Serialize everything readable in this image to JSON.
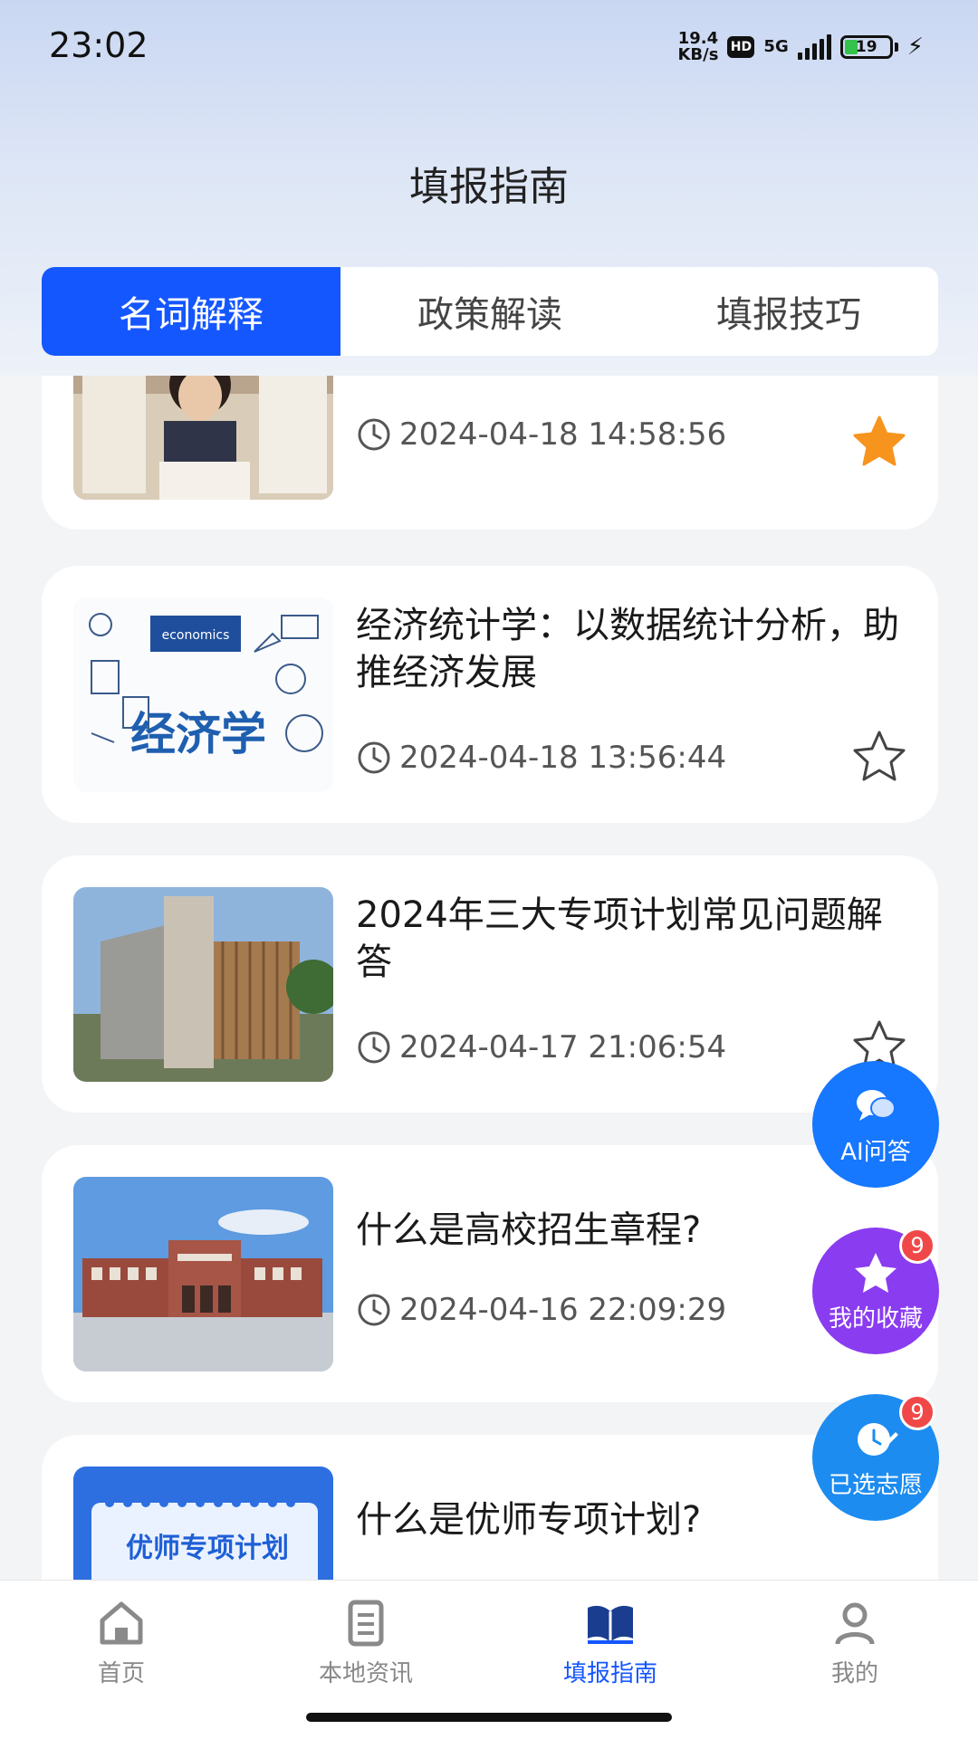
{
  "status_bar": {
    "time": "23:02",
    "net_speed_value": "19.4",
    "net_speed_unit": "KB/s",
    "hd_label": "HD",
    "network": "5G",
    "battery": "19"
  },
  "header": {
    "title": "填报指南"
  },
  "tabs": [
    {
      "label": "名词解释",
      "active": true
    },
    {
      "label": "政策解读",
      "active": false
    },
    {
      "label": "填报技巧",
      "active": false
    }
  ],
  "articles": [
    {
      "title": "",
      "time": "2024-04-18 14:58:56",
      "favorited": true,
      "thumb": "students-reading-photo"
    },
    {
      "title": "经济统计学：以数据统计分析，助推经济发展",
      "time": "2024-04-18 13:56:44",
      "favorited": false,
      "thumb": "economics-doodle"
    },
    {
      "title": "2024年三大专项计划常见问题解答",
      "time": "2024-04-17 21:06:54",
      "favorited": false,
      "thumb": "library-building-photo"
    },
    {
      "title": "什么是高校招生章程?",
      "time": "2024-04-16 22:09:29",
      "favorited": false,
      "thumb": "campus-building-photo"
    },
    {
      "title": "什么是优师专项计划?",
      "time": "",
      "favorited": false,
      "thumb": "youshi-banner"
    }
  ],
  "thumb_texts": {
    "economics_tag": "economics",
    "economics_big": "经济学",
    "youshi_banner": "优师专项计划"
  },
  "fabs": {
    "ai": {
      "label": "AI问答",
      "color": "#1677ff"
    },
    "favorites": {
      "label": "我的收藏",
      "badge": "9",
      "color": "#8a3cf0"
    },
    "selected": {
      "label": "已选志愿",
      "badge": "9",
      "color": "#1c8cf0"
    }
  },
  "bottom_nav": [
    {
      "label": "首页",
      "icon": "home-icon",
      "active": false
    },
    {
      "label": "本地资讯",
      "icon": "document-icon",
      "active": false
    },
    {
      "label": "填报指南",
      "icon": "open-book-icon",
      "active": true
    },
    {
      "label": "我的",
      "icon": "user-icon",
      "active": false
    }
  ],
  "colors": {
    "accent": "#1557ff",
    "star_active": "#f7941d",
    "badge": "#f04848"
  }
}
